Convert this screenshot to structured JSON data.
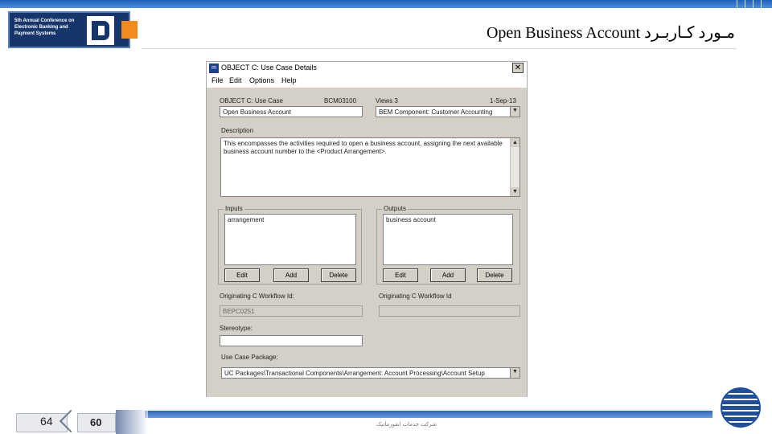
{
  "slide": {
    "title": "Open Business Account مـورد کـاربـرد",
    "page_left": "64",
    "page_right": "60",
    "footer_company": "شرکت خدمات انفورماتیک",
    "logo": {
      "text": "5th Annual Conference on Electronic Banking and Payment Systems"
    }
  },
  "window": {
    "icon_label": "m",
    "title": "OBJECT C: Use Case Details",
    "menu": [
      "File",
      "Edit",
      "Options",
      "Help"
    ],
    "object_label": "OBJECT C: Use Case",
    "object_id": "BCM03100",
    "views_label": "Views 3",
    "date": "1-Sep-13",
    "name_value": "Open Business Account",
    "component_value": "BEM Component: Customer Accounting",
    "description_label": "Description",
    "description_text": "This encompasses the activities required to open a business account, assigning the next available business account number to the <Product Arrangement>.",
    "inputs": {
      "title": "Inputs",
      "items": [
        "arrangement"
      ],
      "edit": "Edit",
      "add": "Add",
      "delete": "Delete"
    },
    "outputs": {
      "title": "Outputs",
      "items": [
        "business account"
      ],
      "edit": "Edit",
      "add": "Add",
      "delete": "Delete"
    },
    "originating_left_label": "Originating C Workflow Id:",
    "originating_left_value": "BEPC0251",
    "originating_right_label": "Originating C Workflow Id",
    "originating_right_value": "",
    "stereotype_label": "Stereotype:",
    "stereotype_value": "",
    "package_label": "Use Case Package:",
    "package_value": "UC Packages\\Transactional Components\\Arrangement: Account Processing\\Account Setup"
  },
  "colors": {
    "brand_navy": "#16356b",
    "brand_orange": "#f28a1e",
    "header_blue": "#1d5fb8",
    "dialog_gray": "#d4d0c8"
  }
}
